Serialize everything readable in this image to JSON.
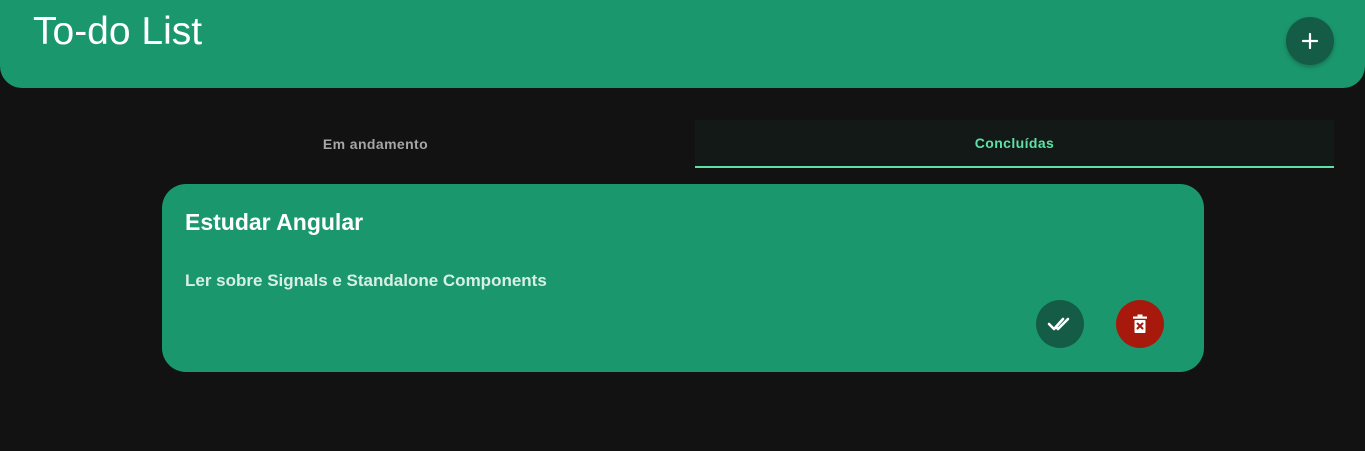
{
  "header": {
    "title": "To-do List",
    "add_icon": "plus-icon",
    "background_color": "#1b976d"
  },
  "tabs": [
    {
      "label": "Em andamento",
      "active": false
    },
    {
      "label": "Concluídas",
      "active": true
    }
  ],
  "tasks": [
    {
      "title": "Estudar Angular",
      "description": "Ler sobre Signals e Standalone Components",
      "actions": [
        {
          "icon": "double-check-icon",
          "color": "#145c45"
        },
        {
          "icon": "trash-icon",
          "color": "#a6190c"
        }
      ]
    }
  ],
  "colors": {
    "accent": "#5fe0a6",
    "background": "#121212"
  }
}
